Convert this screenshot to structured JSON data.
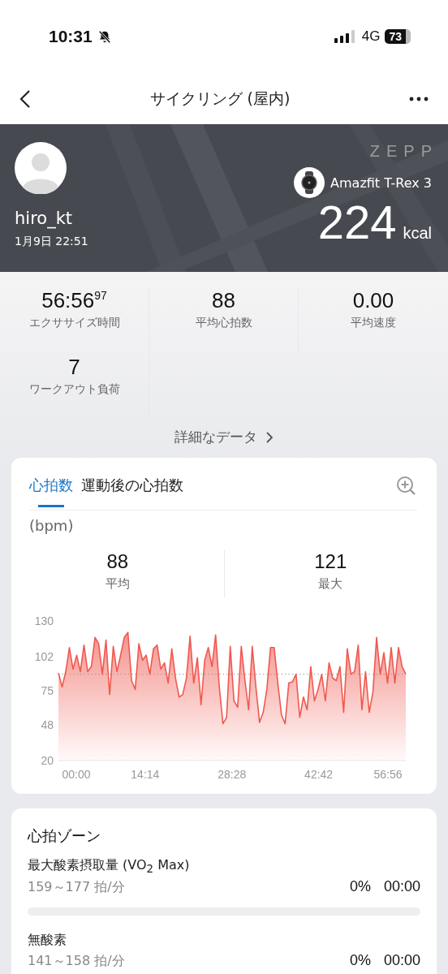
{
  "status_bar": {
    "time": "10:31",
    "network": "4G",
    "battery": "73"
  },
  "nav": {
    "title": "サイクリング (屋内)"
  },
  "banner": {
    "logo": "ZEPP",
    "username": "hiro_kt",
    "date": "1月9日 22:51",
    "device": "Amazfit T-Rex 3",
    "calories": "224",
    "calories_unit": "kcal"
  },
  "stats": [
    {
      "value": "56:56$^{97}$",
      "label": "エクササイズ時間"
    },
    {
      "value": "88",
      "label": "平均心拍数"
    },
    {
      "value": "0.00",
      "label": "平均速度"
    },
    {
      "value": "7",
      "label": "ワークアウト負荷"
    }
  ],
  "details_link": "詳細なデータ",
  "heart_card": {
    "tabs": [
      {
        "label": "心拍数",
        "selected": true
      },
      {
        "label": "運動後の心拍数",
        "selected": false
      }
    ],
    "unit": "(bpm)",
    "summary": [
      {
        "value": "88",
        "label": "平均"
      },
      {
        "value": "121",
        "label": "最大"
      }
    ],
    "chart_data": {
      "type": "area",
      "ylim": [
        20,
        130
      ],
      "xlim": [
        0,
        57
      ],
      "yticks": [
        20,
        48,
        75,
        102,
        130
      ],
      "xticks": [
        {
          "value": 0,
          "label": "00:00"
        },
        {
          "value": 14.23,
          "label": "14:14"
        },
        {
          "value": 28.47,
          "label": "28:28"
        },
        {
          "value": 42.7,
          "label": "42:42"
        },
        {
          "value": 56.93,
          "label": "56:56"
        }
      ],
      "x": [
        0,
        0.6,
        1.2,
        1.8,
        2.4,
        3,
        3.6,
        4.2,
        4.8,
        5.4,
        6,
        6.6,
        7.2,
        7.8,
        8.4,
        9,
        9.6,
        10.2,
        10.8,
        11.4,
        12,
        12.6,
        13.2,
        13.8,
        14.4,
        15,
        15.6,
        16.2,
        16.8,
        17.4,
        18,
        18.6,
        19.2,
        19.8,
        20.4,
        21,
        21.6,
        22.2,
        22.8,
        23.4,
        24,
        24.6,
        25.2,
        25.8,
        26.4,
        27,
        27.6,
        28.2,
        28.8,
        29.4,
        30,
        30.6,
        31.2,
        31.8,
        32.4,
        33,
        33.6,
        34.2,
        34.8,
        35.4,
        36,
        36.6,
        37.2,
        37.8,
        38.4,
        39,
        39.6,
        40.2,
        40.8,
        41.4,
        42,
        42.6,
        43.2,
        43.8,
        44.4,
        45,
        45.6,
        46.2,
        46.8,
        47.4,
        48,
        48.6,
        49.2,
        49.8,
        50.4,
        51,
        51.6,
        52.2,
        52.8,
        53.4,
        54,
        54.6,
        55.2,
        55.8,
        56.4,
        57
      ],
      "series": [
        {
          "color": "#f0584f",
          "values": [
            89,
            78,
            90,
            109,
            92,
            103,
            90,
            111,
            90,
            94,
            117,
            112,
            88,
            115,
            72,
            110,
            90,
            103,
            117,
            121,
            83,
            76,
            112,
            99,
            103,
            88,
            108,
            111,
            92,
            97,
            81,
            108,
            85,
            70,
            72,
            85,
            118,
            81,
            101,
            64,
            99,
            109,
            94,
            119,
            78,
            49,
            54,
            110,
            67,
            62,
            110,
            83,
            60,
            110,
            78,
            50,
            58,
            76,
            109,
            109,
            81,
            56,
            49,
            81,
            82,
            88,
            54,
            70,
            60,
            94,
            67,
            76,
            88,
            67,
            97,
            85,
            83,
            94,
            58,
            108,
            88,
            90,
            111,
            60,
            90,
            58,
            74,
            117,
            88,
            105,
            81,
            109,
            81,
            109,
            94,
            88
          ]
        }
      ]
    }
  },
  "zones_card": {
    "title": "心拍ゾーン",
    "zones": [
      {
        "name": "最大酸素摂取量 (VO$_{2}$ Max)",
        "range": "159～177 拍/分",
        "percent": "0%",
        "duration": "00:00",
        "level": 0
      },
      {
        "name": "無酸素",
        "range": "141～158 拍/分",
        "percent": "0%",
        "duration": "00:00"
      }
    ]
  }
}
